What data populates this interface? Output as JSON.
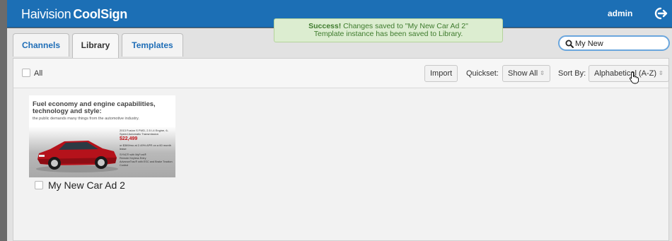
{
  "app": {
    "brand": "Haivision",
    "product": "CoolSign"
  },
  "user": {
    "name": "admin"
  },
  "toast": {
    "title": "Success!",
    "line1": "Changes saved to \"My New Car Ad 2\"",
    "line2": "Template instance has been saved to Library."
  },
  "tabs": [
    {
      "label": "Channels",
      "active": false
    },
    {
      "label": "Library",
      "active": true
    },
    {
      "label": "Templates",
      "active": false
    }
  ],
  "search": {
    "value": "My New"
  },
  "toolbar": {
    "all_label": "All",
    "import_label": "Import",
    "quickset_label": "Quickset:",
    "quickset_value": "Show All",
    "sortby_label": "Sort By:",
    "sortby_value": "Alphabetical (A-Z)"
  },
  "library": {
    "items": [
      {
        "title": "My New Car Ad 2",
        "thumbnail": {
          "headline": "Fuel economy and engine capabilities, technology and style:",
          "subline": "the public demands many things from the automotive industry.",
          "spec": "2013 Fusion S FWD, 2.5 I-4 Engine, 6-Speed Automatic Transmission",
          "price": "$22,499",
          "terms": "or $369/mo at 2.49% APR on a 60 month lease",
          "bullets": [
            "SYNC® with MyFord®",
            "Remote Keyless Entry",
            "AdvanceTrac® with ESC and Brake Traction Control"
          ]
        }
      }
    ]
  },
  "colors": {
    "header": "#1c6fb5",
    "tab_text": "#1f6eb7",
    "toast_bg": "#dcedd0",
    "toast_text": "#3e7b2d",
    "search_border": "#6aa6dd",
    "price": "#c0151a"
  }
}
